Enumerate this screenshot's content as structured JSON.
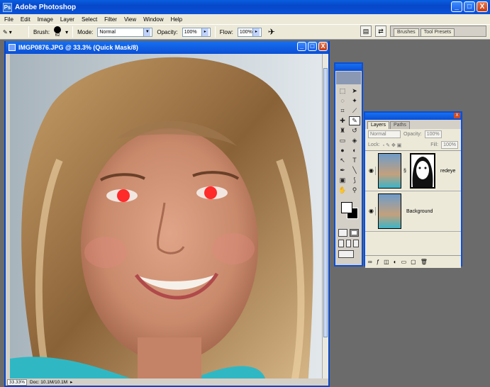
{
  "app": {
    "title": "Adobe Photoshop",
    "icon": "Ps"
  },
  "window_buttons": {
    "minimize": "_",
    "maximize": "□",
    "close": "X"
  },
  "menu": [
    "File",
    "Edit",
    "Image",
    "Layer",
    "Select",
    "Filter",
    "View",
    "Window",
    "Help"
  ],
  "options": {
    "brush_label": "Brush:",
    "brush_size": "62",
    "mode_label": "Mode:",
    "mode_value": "Normal",
    "opacity_label": "Opacity:",
    "opacity_value": "100%",
    "flow_label": "Flow:",
    "flow_value": "100%"
  },
  "palette_well": [
    "Brushes",
    "Tool Presets"
  ],
  "document": {
    "title": "IMGP0876.JPG @ 33.3% (Quick Mask/8)",
    "zoom": "33.33%",
    "status": "Doc: 10.1M/10.1M"
  },
  "layers_panel": {
    "tabs": [
      "Layers",
      "Paths"
    ],
    "blend_mode": "Normal",
    "opacity_label": "Opacity:",
    "opacity_value": "100%",
    "lock_label": "Lock:",
    "fill_label": "Fill:",
    "fill_value": "100%",
    "layers": [
      {
        "name": "redeye",
        "visible": true,
        "has_mask": true
      },
      {
        "name": "Background",
        "visible": true,
        "has_mask": false
      }
    ]
  },
  "colors": {
    "titlebar": "#0a52d8",
    "chrome": "#d4d0c8",
    "foreground": "#ffffff",
    "background": "#000000"
  }
}
